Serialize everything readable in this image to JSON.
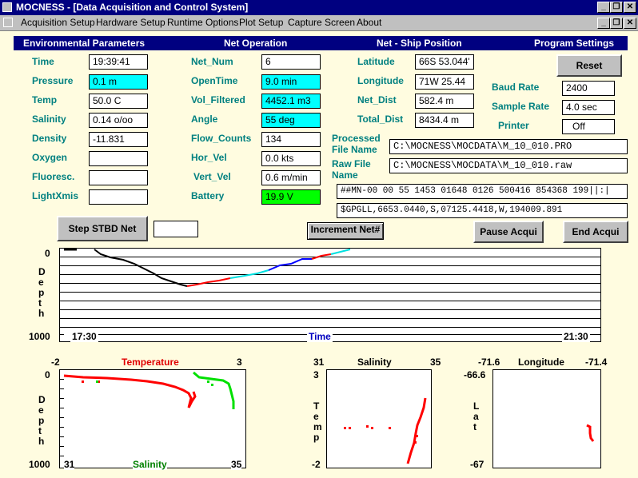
{
  "window": {
    "title": "MOCNESS - [Data Acquisition and Control System]"
  },
  "window_controls": {
    "minimize": "_",
    "restore": "❐",
    "close": "✕"
  },
  "menu": [
    "Acquisition Setup",
    "Hardware Setup",
    "Runtime Options",
    "Plot Setup",
    "Capture Screen",
    "About"
  ],
  "sections": {
    "env": "Environmental Parameters",
    "net": "Net Operation",
    "ship": "Net - Ship Position",
    "prog": "Program Settings"
  },
  "env": [
    {
      "label": "Time",
      "value": "19:39:41"
    },
    {
      "label": "Pressure",
      "value": "0.1 m"
    },
    {
      "label": "Temp",
      "value": "50.0 C"
    },
    {
      "label": "Salinity",
      "value": "0.14 o/oo"
    },
    {
      "label": "Density",
      "value": "-11.831"
    },
    {
      "label": "Oxygen",
      "value": ""
    },
    {
      "label": "Fluoresc.",
      "value": ""
    },
    {
      "label": "LightXmis",
      "value": ""
    }
  ],
  "net": [
    {
      "label": "Net_Num",
      "value": "6"
    },
    {
      "label": "OpenTime",
      "value": "9.0 min"
    },
    {
      "label": "Vol_Filtered",
      "value": "4452.1 m3"
    },
    {
      "label": "Angle",
      "value": "55 deg"
    },
    {
      "label": "Flow_Counts",
      "value": "134"
    },
    {
      "label": "Hor_Vel",
      "value": "0.0 kts"
    },
    {
      "label": "Vert_Vel",
      "value": "0.6 m/min"
    },
    {
      "label": "Battery",
      "value": "19.9 V"
    }
  ],
  "ship": [
    {
      "label": "Latitude",
      "value": "66S 53.044'"
    },
    {
      "label": "Longitude",
      "value": "71W 25.44"
    },
    {
      "label": "Net_Dist",
      "value": "582.4 m"
    },
    {
      "label": "Total_Dist",
      "value": "8434.4 m"
    }
  ],
  "files": {
    "processed_label": "Processed File Name",
    "processed_value": "C:\\MOCNESS\\MOCDATA\\M_10_010.PRO",
    "raw_label": "Raw File Name",
    "raw_value": "C:\\MOCNESS\\MOCDATA\\M_10_010.raw",
    "raw_line1": "##MN-00 00 55 1453 01648 0126 500416 854368 199||:|",
    "raw_line2": "$GPGLL,6653.0440,S,07125.4418,W,194009.891"
  },
  "settings": {
    "reset": "Reset",
    "baud_label": "Baud Rate",
    "baud_value": "2400",
    "sample_label": "Sample Rate",
    "sample_value": "4.0 sec",
    "printer_label": "Printer",
    "printer_value": "Off"
  },
  "buttons": {
    "step": "Step STBD Net",
    "increment": "Increment Net#",
    "pause": "Pause Acqui",
    "end": "End Acqui"
  },
  "step_input": "",
  "colors": {
    "bg": "#fffce0",
    "header": "#000080",
    "label": "#008080",
    "cyan": "#00ffff",
    "green": "#00ff00",
    "red": "#ff0000",
    "blue": "#0000ff"
  },
  "time_plot": {
    "y_top": "0",
    "y_bottom": "1000",
    "y_label": "Depth",
    "x_start": "17:30",
    "x_end": "21:30",
    "x_label": "Time"
  },
  "temp_plot": {
    "t_min": "-2",
    "t_max": "3",
    "t_label": "Temperature",
    "s_min": "31",
    "s_max": "35",
    "s_label": "Salinity",
    "y_top": "0",
    "y_bottom": "1000",
    "y_label": "Depth"
  },
  "ts_plot": {
    "x_min": "31",
    "x_max": "35",
    "x_label": "Salinity",
    "y_top": "3",
    "y_bottom": "-2",
    "y_label": "Temp"
  },
  "pos_plot": {
    "x_min": "-71.6",
    "x_max": "-71.4",
    "x_label": "Longitude",
    "y_top": "-66.6",
    "y_bottom": "-67",
    "y_label": "Lat"
  }
}
